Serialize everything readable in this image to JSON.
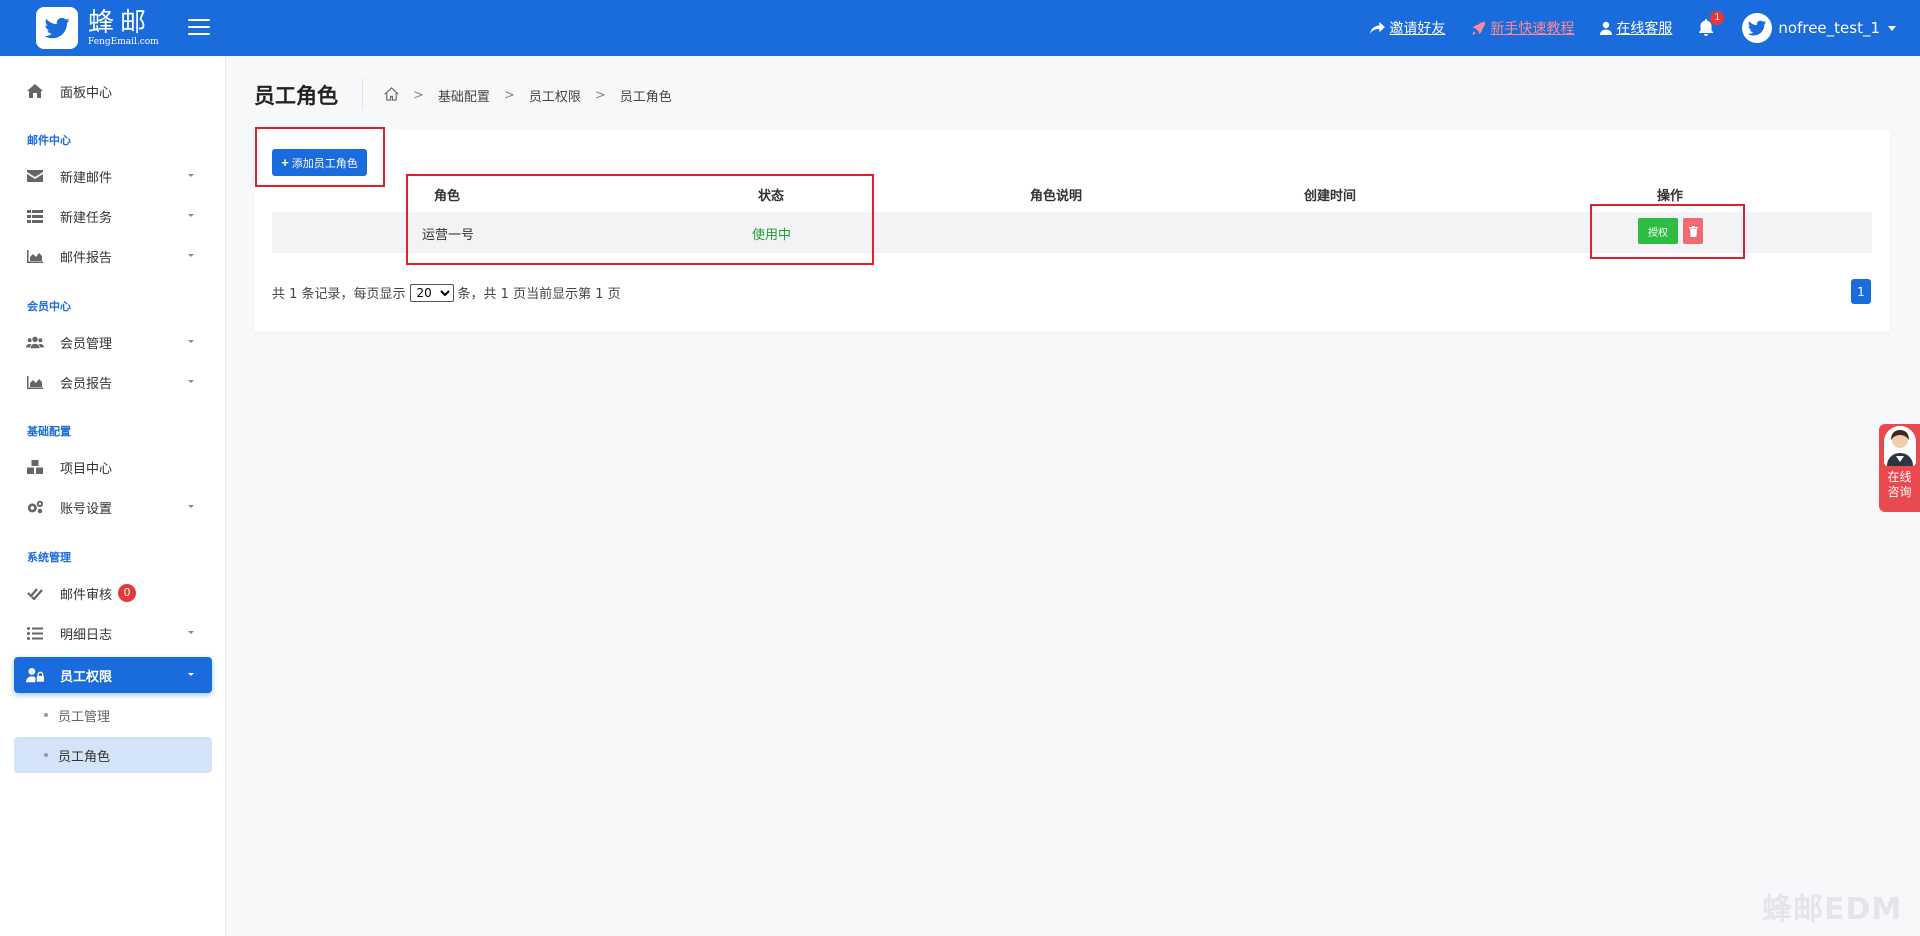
{
  "brand": {
    "name": "蜂邮",
    "domain": "FengEmail.com"
  },
  "header": {
    "invite": "邀请好友",
    "tutorial": "新手快速教程",
    "service": "在线客服",
    "notif_count": "1",
    "username": "nofree_test_1"
  },
  "sidebar": {
    "dashboard": "面板中心",
    "section_mail": "邮件中心",
    "new_mail": "新建邮件",
    "new_task": "新建任务",
    "mail_report": "邮件报告",
    "section_member": "会员中心",
    "member_mgmt": "会员管理",
    "member_report": "会员报告",
    "section_base": "基础配置",
    "project_center": "项目中心",
    "account_settings": "账号设置",
    "section_system": "系统管理",
    "mail_review": "邮件审核",
    "mail_review_count": "0",
    "detail_log": "明细日志",
    "staff_perm": "员工权限",
    "staff_mgmt": "员工管理",
    "staff_role": "员工角色"
  },
  "page": {
    "title": "员工角色",
    "breadcrumb": [
      "基础配置",
      "员工权限",
      "员工角色"
    ]
  },
  "toolbar": {
    "add_role_label": "添加员工角色"
  },
  "table": {
    "headers": {
      "role": "角色",
      "status": "状态",
      "desc": "角色说明",
      "created": "创建时间",
      "ops": "操作"
    },
    "rows": [
      {
        "role": "运营一号",
        "status": "使用中",
        "desc": "",
        "created": "",
        "grant_label": "授权"
      }
    ]
  },
  "pager": {
    "prefix": "共 1 条记录，每页显示",
    "page_size": "20",
    "page_size_options": [
      "20"
    ],
    "suffix": "条，共 1 页当前显示第 1 页",
    "current_page": "1"
  },
  "consult": {
    "label_line1": "在线",
    "label_line2": "咨询"
  },
  "watermark": "蜂邮EDM",
  "colors": {
    "primary": "#1a6bdb",
    "success": "#2dbd43",
    "danger": "#f06a72",
    "annotation": "#e0202a"
  }
}
